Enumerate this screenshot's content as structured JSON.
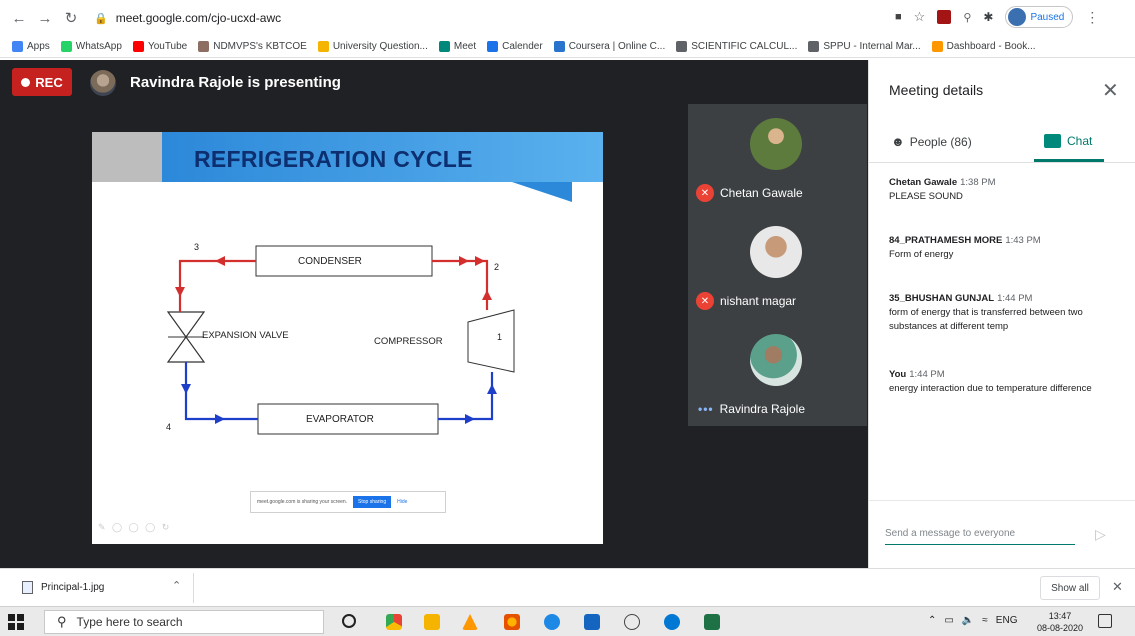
{
  "browser": {
    "url": "meet.google.com/cjo-ucxd-awc",
    "profile_status": "Paused",
    "bookmarks": [
      {
        "label": "Apps",
        "color": "#4285f4"
      },
      {
        "label": "WhatsApp",
        "color": "#25d366"
      },
      {
        "label": "YouTube",
        "color": "#ff0000"
      },
      {
        "label": "NDMVPS's KBTCOE",
        "color": "#8d6e63"
      },
      {
        "label": "University Question...",
        "color": "#f4b400"
      },
      {
        "label": "Meet",
        "color": "#00897b"
      },
      {
        "label": "Calender",
        "color": "#1a73e8"
      },
      {
        "label": "Coursera | Online C...",
        "color": "#2a73cc"
      },
      {
        "label": "SCIENTIFIC CALCUL...",
        "color": "#5f6368"
      },
      {
        "label": "SPPU - Internal Mar...",
        "color": "#5f6368"
      },
      {
        "label": "Dashboard - Book...",
        "color": "#ff9800"
      }
    ]
  },
  "meeting": {
    "rec_label": "REC",
    "presenting_text": "Ravindra Rajole is presenting",
    "slide": {
      "title": "REFRIGERATION CYCLE",
      "labels": {
        "condenser": "CONDENSER",
        "evaporator": "EVAPORATOR",
        "expansion_valve": "EXPANSION VALVE",
        "compressor": "COMPRESSOR",
        "n1": "1",
        "n2": "2",
        "n3": "3",
        "n4": "4"
      },
      "share_bar": {
        "text": "meet.google.com is sharing your screen.",
        "stop": "Stop sharing",
        "hide": "Hide"
      }
    },
    "participants": [
      {
        "name": "Chetan Gawale",
        "status": "muted"
      },
      {
        "name": "nishant magar",
        "status": "muted"
      },
      {
        "name": "Ravindra Rajole",
        "status": "more"
      }
    ]
  },
  "panel": {
    "title": "Meeting details",
    "people_tab": "People (86)",
    "chat_tab": "Chat",
    "messages": [
      {
        "sender": "Chetan Gawale",
        "time": "1:38 PM",
        "text": "PLEASE SOUND"
      },
      {
        "sender": "84_PRATHAMESH MORE",
        "time": "1:43 PM",
        "text": "Form of energy"
      },
      {
        "sender": "35_BHUSHAN GUNJAL",
        "time": "1:44 PM",
        "text": "form of energy that is transferred between two substances at different temp"
      },
      {
        "sender": "You",
        "time": "1:44 PM",
        "text": "energy interaction due to temperature difference"
      }
    ],
    "compose_placeholder": "Send a message to everyone"
  },
  "downloads": {
    "file_name": "Principal-1.jpg",
    "show_all": "Show all"
  },
  "taskbar": {
    "search_placeholder": "Type here to search",
    "language": "ENG",
    "time": "13:47",
    "date": "08-08-2020"
  }
}
